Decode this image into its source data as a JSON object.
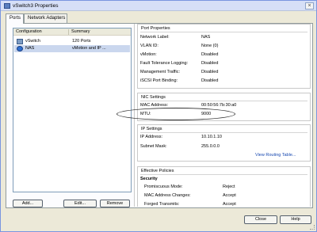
{
  "window": {
    "title": "vSwitch3 Properties",
    "close_glyph": "×"
  },
  "tabs": [
    {
      "label": "Ports",
      "active": true
    },
    {
      "label": "Network Adapters",
      "active": false
    }
  ],
  "list": {
    "columns": [
      "Configuration",
      "Summary"
    ],
    "rows": [
      {
        "name": "vSwitch",
        "summary": "120 Ports",
        "icon": "switch-icon",
        "selected": false
      },
      {
        "name": "NAS",
        "summary": "vMotion and IP ...",
        "icon": "vmkernel-port-icon",
        "selected": true
      }
    ]
  },
  "list_buttons": {
    "add": "Add...",
    "edit": "Edit...",
    "remove": "Remove"
  },
  "port_properties": {
    "title": "Port Properties",
    "rows": [
      {
        "label": "Network Label:",
        "value": "NAS"
      },
      {
        "label": "VLAN ID:",
        "value": "None (0)"
      },
      {
        "label": "vMotion:",
        "value": "Disabled"
      },
      {
        "label": "Fault Tolerance Logging:",
        "value": "Disabled"
      },
      {
        "label": "Management Traffic:",
        "value": "Disabled"
      },
      {
        "label": "iSCSI Port Binding:",
        "value": "Disabled"
      }
    ]
  },
  "nic_settings": {
    "title": "NIC Settings",
    "rows": [
      {
        "label": "MAC Address:",
        "value": "00:50:56:7b:30:a0"
      },
      {
        "label": "MTU:",
        "value": "9000"
      }
    ]
  },
  "ip_settings": {
    "title": "IP Settings",
    "rows": [
      {
        "label": "IP Address:",
        "value": "10.10.1.10"
      },
      {
        "label": "Subnet Mask:",
        "value": "255.0.0.0"
      }
    ],
    "link": "View Routing Table..."
  },
  "effective_policies": {
    "title": "Effective Policies",
    "section": "Security",
    "rows": [
      {
        "label": "Promiscuous Mode:",
        "value": "Reject"
      },
      {
        "label": "MAC Address Changes:",
        "value": "Accept"
      },
      {
        "label": "Forged Transmits:",
        "value": "Accept"
      }
    ]
  },
  "footer": {
    "close": "Close",
    "help": "Help"
  }
}
